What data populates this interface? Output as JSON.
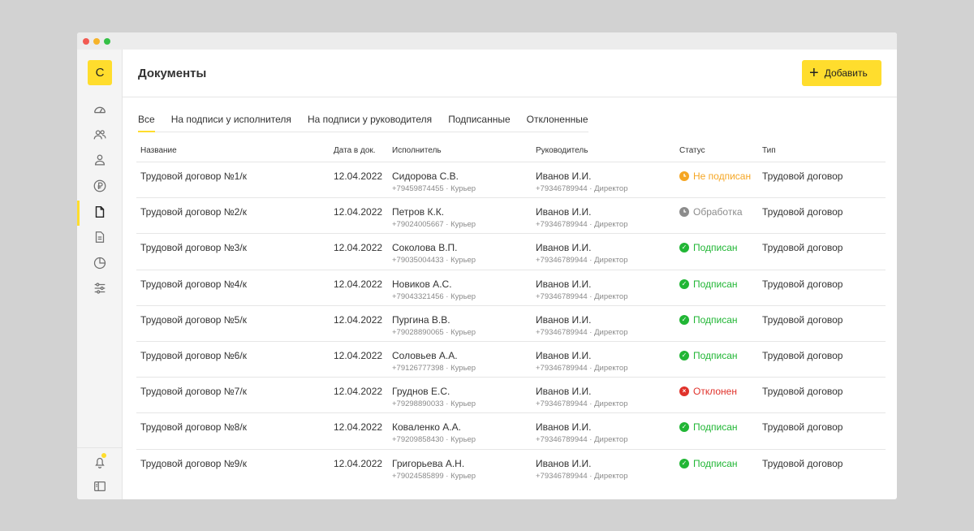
{
  "logo": {
    "letter": "С"
  },
  "sidebar": {
    "items": [
      {
        "name": "dashboard-icon"
      },
      {
        "name": "users-icon"
      },
      {
        "name": "person-icon"
      },
      {
        "name": "ruble-icon"
      },
      {
        "name": "document-icon",
        "active": true
      },
      {
        "name": "document-text-icon"
      },
      {
        "name": "pie-chart-icon"
      },
      {
        "name": "settings-sliders-icon"
      }
    ],
    "bottom": [
      {
        "name": "bell-icon"
      },
      {
        "name": "panel-icon"
      }
    ]
  },
  "header": {
    "title": "Документы",
    "add_button": "Добавить"
  },
  "tabs": [
    "Все",
    "На подписи у исполнителя",
    "На подписи у руководителя",
    "Подписанные",
    "Отклоненные"
  ],
  "table": {
    "columns": [
      "Название",
      "Дата в док.",
      "Исполнитель",
      "Руководитель",
      "Статус",
      "Тип"
    ],
    "rows": [
      {
        "name": "Трудовой договор №1/к",
        "date": "12.04.2022",
        "exec": "Сидорова С.В.",
        "exec_sub": "+79459874455 · Курьер",
        "mgr": "Иванов И.И.",
        "mgr_sub": "+79346789944 · Директор",
        "status": "Не подписан",
        "status_kind": "pending",
        "type": "Трудовой договор"
      },
      {
        "name": "Трудовой договор №2/к",
        "date": "12.04.2022",
        "exec": "Петров К.К.",
        "exec_sub": "+79024005667 · Курьер",
        "mgr": "Иванов И.И.",
        "mgr_sub": "+79346789944 · Директор",
        "status": "Обработка",
        "status_kind": "processing",
        "type": "Трудовой договор"
      },
      {
        "name": "Трудовой договор №3/к",
        "date": "12.04.2022",
        "exec": "Соколова В.П.",
        "exec_sub": "+79035004433 · Курьер",
        "mgr": "Иванов И.И.",
        "mgr_sub": "+79346789944 · Директор",
        "status": "Подписан",
        "status_kind": "signed",
        "type": "Трудовой договор"
      },
      {
        "name": "Трудовой договор №4/к",
        "date": "12.04.2022",
        "exec": "Новиков А.С.",
        "exec_sub": "+79043321456 · Курьер",
        "mgr": "Иванов И.И.",
        "mgr_sub": "+79346789944 · Директор",
        "status": "Подписан",
        "status_kind": "signed",
        "type": "Трудовой договор"
      },
      {
        "name": "Трудовой договор №5/к",
        "date": "12.04.2022",
        "exec": "Пургина В.В.",
        "exec_sub": "+79028890065 · Курьер",
        "mgr": "Иванов И.И.",
        "mgr_sub": "+79346789944 · Директор",
        "status": "Подписан",
        "status_kind": "signed",
        "type": "Трудовой договор"
      },
      {
        "name": "Трудовой договор №6/к",
        "date": "12.04.2022",
        "exec": "Соловьев А.А.",
        "exec_sub": "+79126777398 · Курьер",
        "mgr": "Иванов И.И.",
        "mgr_sub": "+79346789944 · Директор",
        "status": "Подписан",
        "status_kind": "signed",
        "type": "Трудовой договор"
      },
      {
        "name": "Трудовой договор №7/к",
        "date": "12.04.2022",
        "exec": "Груднов Е.С.",
        "exec_sub": "+79298890033 · Курьер",
        "mgr": "Иванов И.И.",
        "mgr_sub": "+79346789944 · Директор",
        "status": "Отклонен",
        "status_kind": "rejected",
        "type": "Трудовой договор"
      },
      {
        "name": "Трудовой договор №8/к",
        "date": "12.04.2022",
        "exec": "Коваленко А.А.",
        "exec_sub": "+79209858430 · Курьер",
        "mgr": "Иванов И.И.",
        "mgr_sub": "+79346789944 · Директор",
        "status": "Подписан",
        "status_kind": "signed",
        "type": "Трудовой договор"
      },
      {
        "name": "Трудовой договор №9/к",
        "date": "12.04.2022",
        "exec": "Григорьева А.Н.",
        "exec_sub": "+79024585899 · Курьер",
        "mgr": "Иванов И.И.",
        "mgr_sub": "+79346789944 · Директор",
        "status": "Подписан",
        "status_kind": "signed",
        "type": "Трудовой договор"
      }
    ]
  },
  "status_colors": {
    "pending": "#f5a623",
    "processing": "#8c8c8c",
    "signed": "#21b635",
    "rejected": "#e0322b"
  },
  "accent_color": "#ffdd2d"
}
